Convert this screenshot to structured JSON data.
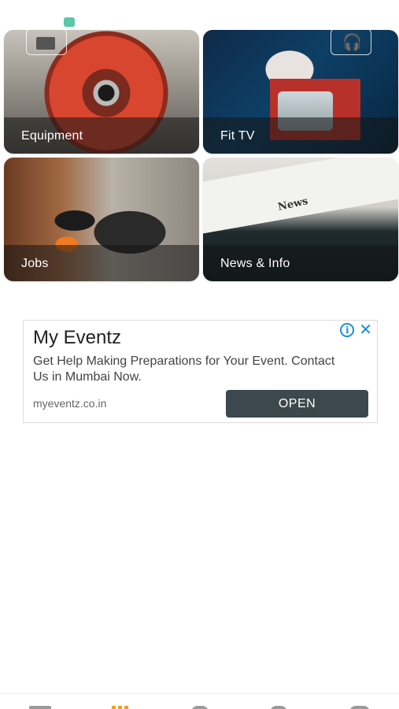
{
  "tiles": [
    {
      "label": "Equipment"
    },
    {
      "label": "Fit TV"
    },
    {
      "label": "Jobs"
    },
    {
      "label": "News & Info",
      "paper_text": "News"
    }
  ],
  "ad": {
    "title": "My Eventz",
    "description": "Get Help Making Preparations for Your Event. Contact Us in Mumbai Now.",
    "url": "myeventz.co.in",
    "button_label": "OPEN",
    "info_symbol": "i",
    "close_symbol": "✕"
  },
  "bottom_nav": {
    "items": [
      "home-icon",
      "grid-icon",
      "search-icon",
      "info-icon",
      "user-icon"
    ],
    "active": "grid-icon",
    "accent_color": "#f2a014"
  },
  "colors": {
    "ad_button": "#3b484e",
    "ad_icons": "#1a8de0",
    "status_marker": "#57c8a8"
  }
}
